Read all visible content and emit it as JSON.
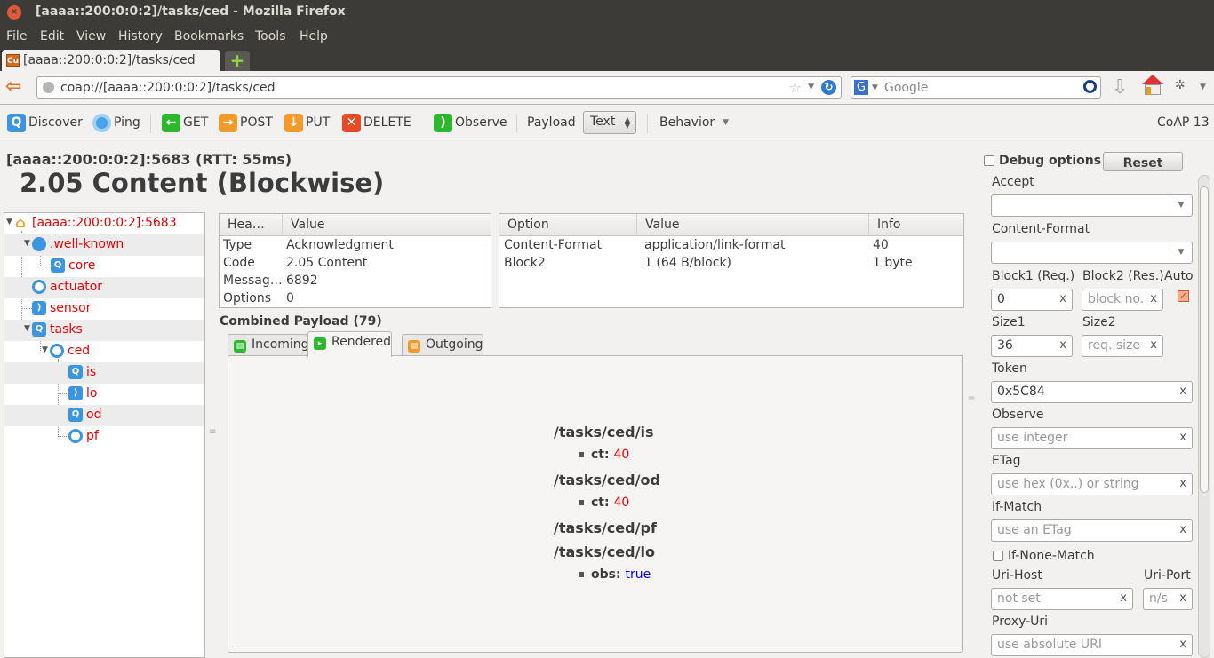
{
  "window": {
    "title": "[aaaa::200:0:0:2]/tasks/ced - Mozilla Firefox"
  },
  "menu": [
    "File",
    "Edit",
    "View",
    "History",
    "Bookmarks",
    "Tools",
    "Help"
  ],
  "browser": {
    "tab_title": "[aaaa::200:0:0:2]/tasks/ced",
    "favicon_text": "Cu",
    "url": "coap://[aaaa::200:0:0:2]/tasks/ced",
    "search_placeholder": "Google",
    "search_engine_icon": "G"
  },
  "toolbar": {
    "discover": "Discover",
    "ping": "Ping",
    "get": "GET",
    "post": "POST",
    "put": "PUT",
    "delete": "DELETE",
    "observe": "Observe",
    "payload_label": "Payload",
    "payload_format": "Text",
    "behavior": "Behavior",
    "version": "CoAP 13"
  },
  "status": {
    "endpoint": "[aaaa::200:0:0:2]:5683 (RTT: 55ms)",
    "code": "2.05 Content (Blockwise)"
  },
  "tree": [
    {
      "label": "[aaaa::200:0:0:2]:5683",
      "icon": "home-icon",
      "expanded": true
    },
    {
      "label": ".well-known",
      "icon": "globe-icon",
      "expanded": true
    },
    {
      "label": "core",
      "icon": "discover-icon"
    },
    {
      "label": "actuator",
      "icon": "ping-icon"
    },
    {
      "label": "sensor",
      "icon": "observe-icon"
    },
    {
      "label": "tasks",
      "icon": "discover-icon",
      "expanded": true
    },
    {
      "label": "ced",
      "icon": "ping-icon",
      "expanded": true
    },
    {
      "label": "is",
      "icon": "discover-icon"
    },
    {
      "label": "lo",
      "icon": "observe-icon"
    },
    {
      "label": "od",
      "icon": "discover-icon"
    },
    {
      "label": "pf",
      "icon": "ping-icon"
    }
  ],
  "header_table": {
    "columns": [
      "Hea…",
      "Value"
    ],
    "rows": [
      [
        "Type",
        "Acknowledgment"
      ],
      [
        "Code",
        "2.05 Content"
      ],
      [
        "Messag…",
        "6892"
      ],
      [
        "Options",
        "0"
      ]
    ]
  },
  "options_table": {
    "columns": [
      "Option",
      "Value",
      "Info"
    ],
    "rows": [
      [
        "Content-Format",
        "application/link-format",
        "40"
      ],
      [
        "Block2",
        "1 (64 B/block)",
        "1 byte"
      ]
    ]
  },
  "payload": {
    "title": "Combined Payload (79)",
    "tabs": [
      "Incoming",
      "Rendered",
      "Outgoing"
    ],
    "active_tab": "Rendered",
    "resources": [
      {
        "path": "/tasks/ced/is",
        "attrs": [
          {
            "key": "ct:",
            "value": "40",
            "type": "number"
          }
        ]
      },
      {
        "path": "/tasks/ced/od",
        "attrs": [
          {
            "key": "ct:",
            "value": "40",
            "type": "number"
          }
        ]
      },
      {
        "path": "/tasks/ced/pf",
        "attrs": []
      },
      {
        "path": "/tasks/ced/lo",
        "attrs": [
          {
            "key": "obs:",
            "value": "true",
            "type": "bool"
          }
        ]
      }
    ]
  },
  "options_panel": {
    "debug_label": "Debug options",
    "debug_checked": false,
    "reset": "Reset",
    "accept_label": "Accept",
    "accept_value": "",
    "content_format_label": "Content-Format",
    "content_format_value": "",
    "block1_label": "Block1 (Req.)",
    "block1_value": "0",
    "block2_label": "Block2 (Res.)",
    "block2_placeholder": "block no.",
    "auto_label": "Auto",
    "auto_checked": true,
    "size1_label": "Size1",
    "size1_value": "36",
    "size2_label": "Size2",
    "size2_placeholder": "req. size",
    "token_label": "Token",
    "token_value": "0x5C84",
    "observe_label": "Observe",
    "observe_placeholder": "use integer",
    "etag_label": "ETag",
    "etag_placeholder": "use hex (0x..) or string",
    "ifmatch_label": "If-Match",
    "ifmatch_placeholder": "use an ETag",
    "ifnonematch_label": "If-None-Match",
    "ifnonematch_checked": false,
    "urihost_label": "Uri-Host",
    "urihost_placeholder": "not set",
    "uriport_label": "Uri-Port",
    "uriport_placeholder": "n/s",
    "proxyuri_label": "Proxy-Uri",
    "proxyuri_placeholder": "use absolute URI",
    "clear_glyph": "x"
  },
  "colors": {
    "tree_text": "#e00000",
    "number_value": "#e00000",
    "bool_value": "#0000e0",
    "titlebar_bg": "#3c3b37"
  }
}
